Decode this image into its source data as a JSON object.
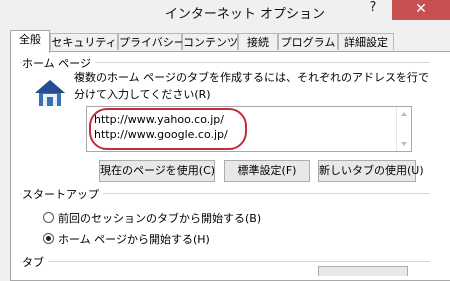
{
  "window": {
    "title": "インターネット オプション",
    "help_label": "?",
    "close_label": "✕"
  },
  "tabs": [
    {
      "label": "全般",
      "active": true
    },
    {
      "label": "セキュリティ",
      "active": false
    },
    {
      "label": "プライバシー",
      "active": false
    },
    {
      "label": "コンテンツ",
      "active": false
    },
    {
      "label": "接続",
      "active": false
    },
    {
      "label": "プログラム",
      "active": false
    },
    {
      "label": "詳細設定",
      "active": false
    }
  ],
  "home_page": {
    "group_label": "ホーム ページ",
    "description": "複数のホーム ページのタブを作成するには、それぞれのアドレスを行で分けて入力してください(R)",
    "urls": [
      "http://www.yahoo.co.jp/",
      "http://www.google.co.jp/"
    ],
    "icon": "house-icon",
    "buttons": {
      "use_current": "現在のページを使用(C)",
      "use_default": "標準設定(F)",
      "use_new_tab": "新しいタブの使用(U)"
    }
  },
  "startup": {
    "group_label": "スタートアップ",
    "options": [
      {
        "label": "前回のセッションのタブから開始する(B)",
        "selected": false
      },
      {
        "label": "ホーム ページから開始する(H)",
        "selected": true
      }
    ]
  },
  "tabs_section": {
    "group_label": "タブ"
  },
  "colors": {
    "close_button": "#c75050",
    "highlight_ellipse": "#c0303a"
  }
}
